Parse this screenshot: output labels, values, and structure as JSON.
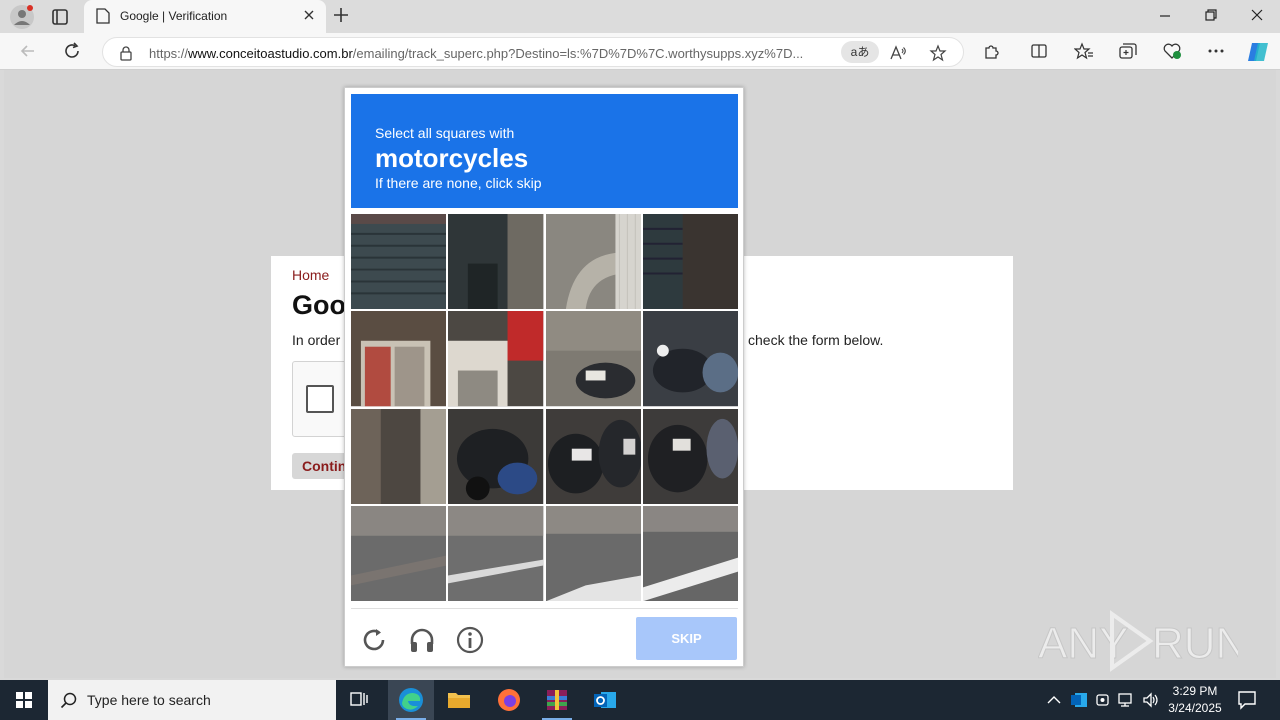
{
  "browser": {
    "tab_title": "Google | Verification",
    "url_prefix": "https://",
    "url_domain": "www.conceitoastudio.com.br",
    "url_rest": "/emailing/track_superc.php?Destino=ls:%7D%7D%7C.worthysupps.xyz%7D...",
    "read_aloud_label": "aあ"
  },
  "page": {
    "breadcrumb_home": "Home",
    "heading_partial": "Goo",
    "intro_left": "In order",
    "intro_right": "check the form below.",
    "continue_partial": "Contin"
  },
  "captcha": {
    "instruction_line1": "Select all squares with",
    "target": "motorcycles",
    "instruction_line3": "If there are none, click skip",
    "skip_label": "SKIP",
    "accent_color": "#1a73e8",
    "tiles_count": 16
  },
  "watermark": {
    "text": "ANY RUN"
  },
  "taskbar": {
    "search_placeholder": "Type here to search",
    "time": "3:29 PM",
    "date": "3/24/2025"
  }
}
